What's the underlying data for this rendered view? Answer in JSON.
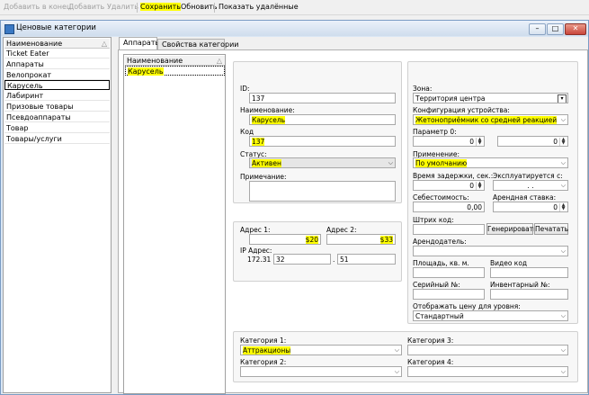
{
  "toolbar": {
    "add_end": "Добавить в конец",
    "add": "Добавить",
    "delete": "Удалить",
    "save": "Сохранить",
    "refresh": "Обновить",
    "show_deleted": "Показать удалённые"
  },
  "window": {
    "title": "Ценовые категории"
  },
  "categories": {
    "header": "Наименование",
    "sort_icon": "△",
    "items": [
      "Ticket Eater",
      "Аппараты",
      "Велопрокат",
      "Карусель",
      "Лабиринт",
      "Призовые товары",
      "Псевдоаппараты",
      "Товар",
      "Товары/услуги"
    ],
    "selected": "Карусель"
  },
  "tabs": [
    "Аппараты",
    "Свойства категории"
  ],
  "machines": {
    "header": "Наименование",
    "sort_icon": "△",
    "items": [
      "Карусель"
    ]
  },
  "form": {
    "id_label": "ID:",
    "id_value": "137",
    "name_label": "Наименование:",
    "name_value": "Карусель",
    "code_label": "Код",
    "code_value": "137",
    "status_label": "Статус:",
    "status_value": "Активен",
    "note_label": "Примечание:",
    "note_value": "",
    "addr1_label": "Адрес 1:",
    "addr1_value": "$20",
    "addr2_label": "Адрес 2:",
    "addr2_value": "$33",
    "ip_label": "IP Адрес:",
    "ip_prefix": "172.31",
    "ip_part3": "32",
    "ip_dot": ".",
    "ip_part4": "51",
    "zone_label": "Зона:",
    "zone_value": "Территория центра",
    "config_label": "Конфигурация устройства:",
    "config_value": "Жетоноприёмник со средней реакцией",
    "param0_label": "Параметр 0:",
    "param0_a": "0",
    "param0_b": "0",
    "apply_label": "Применение:",
    "apply_value": "По умолчанию",
    "delay_label": "Время задержки, сек.:",
    "delay_value": "0",
    "exploit_label": "Эксплуатируется с:",
    "exploit_value": ". .",
    "cost_label": "Себестоимость:",
    "cost_value": "0,00",
    "rent_label": "Арендная ставка:",
    "rent_value": "0",
    "barcode_label": "Штрих код:",
    "barcode_value": "",
    "generate_btn": "Генерировать",
    "print_btn": "Печатать",
    "lessor_label": "Арендодатель:",
    "lessor_value": "",
    "area_label": "Площадь, кв. м.",
    "area_value": "",
    "video_label": "Видео код",
    "video_value": "",
    "serial_label": "Серийный №:",
    "serial_value": "",
    "inventory_label": "Инвентарный №:",
    "inventory_value": "",
    "price_level_label": "Отображать цену для уровня:",
    "price_level_value": "Стандартный",
    "cat1_label": "Категория 1:",
    "cat1_value": "Аттракционы",
    "cat2_label": "Категория 2:",
    "cat2_value": "",
    "cat3_label": "Категория 3:",
    "cat3_value": "",
    "cat4_label": "Категория 4:",
    "cat4_value": ""
  },
  "colors": {
    "highlight": "#ffff00",
    "window_border": "#7a9cc4"
  }
}
